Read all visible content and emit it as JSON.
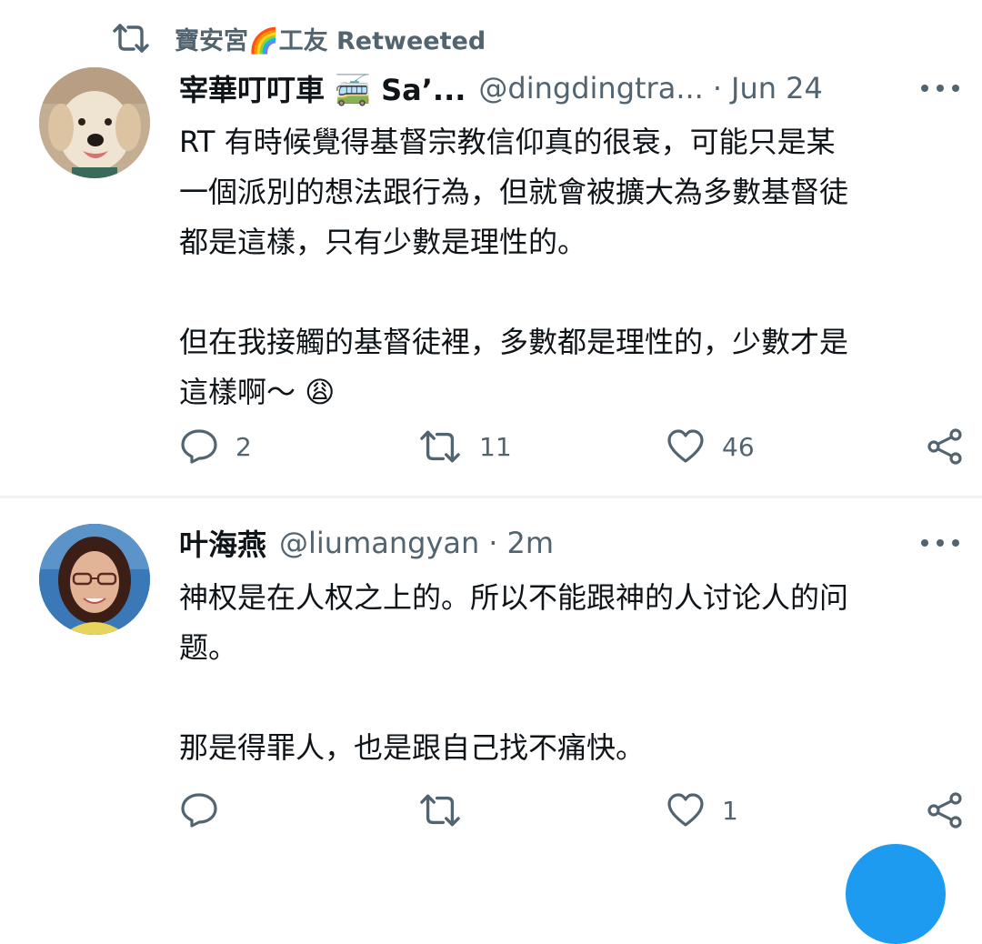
{
  "retweet_context": {
    "label": "寶安宮🌈工友 Retweeted"
  },
  "tweets": [
    {
      "avatar": "dog-avatar",
      "name": "宰華叮叮車 🚎 Sa’...",
      "handle": "@dingdingtra...",
      "separator": "·",
      "time": "Jun 24",
      "text": "RT 有時候覺得基督宗教信仰真的很衰，可能只是某\n一個派別的想法跟行為，但就會被擴大為多數基督徒\n都是這樣，只有少數是理性的。\n\n但在我接觸的基督徒裡，多數都是理性的，少數才是\n這樣啊～ 😩",
      "replies": "2",
      "retweets": "11",
      "likes": "46"
    },
    {
      "avatar": "woman-avatar",
      "name": "叶海燕",
      "handle": "@liumangyan",
      "separator": "·",
      "time": "2m",
      "text": "神权是在人权之上的。所以不能跟神的人讨论人的问\n题。\n\n那是得罪人，也是跟自己找不痛快。",
      "replies": "",
      "retweets": "",
      "likes": "1"
    }
  ],
  "icons": {
    "retweet": "retweet-icon",
    "reply": "reply-icon",
    "like": "heart-icon",
    "share": "share-icon",
    "more": "more-icon"
  },
  "colors": {
    "text": "#0f1419",
    "secondary": "#536471",
    "divider": "#eff3f4",
    "accent": "#1d9bf0"
  }
}
